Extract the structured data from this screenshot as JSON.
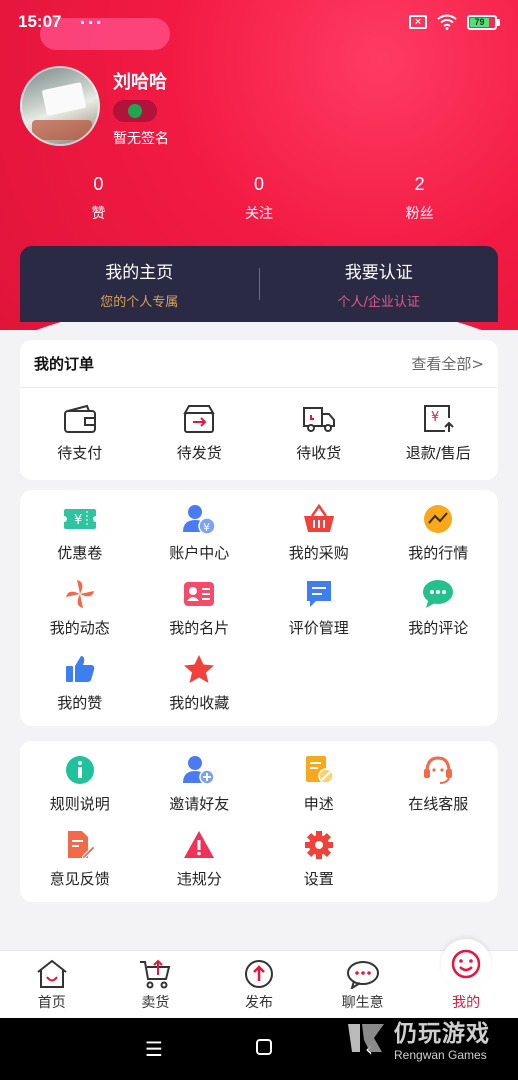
{
  "status": {
    "time": "15:07",
    "dots": "···",
    "battery": "79"
  },
  "profile": {
    "name": "刘哈哈",
    "signature": "暂无签名"
  },
  "stats": [
    {
      "value": "0",
      "label": "赞"
    },
    {
      "value": "0",
      "label": "关注"
    },
    {
      "value": "2",
      "label": "粉丝"
    }
  ],
  "home_card": {
    "left": {
      "title": "我的主页",
      "subtitle": "您的个人专属"
    },
    "right": {
      "title": "我要认证",
      "subtitle": "个人/企业认证"
    }
  },
  "orders": {
    "title": "我的订单",
    "view_all": "查看全部>",
    "items": [
      {
        "label": "待支付",
        "icon": "wallet-icon"
      },
      {
        "label": "待发货",
        "icon": "box-send-icon"
      },
      {
        "label": "待收货",
        "icon": "truck-icon"
      },
      {
        "label": "退款/售后",
        "icon": "refund-icon"
      }
    ]
  },
  "services": {
    "items": [
      {
        "label": "优惠卷",
        "icon": "coupon-icon",
        "color": "#2fc4a0"
      },
      {
        "label": "账户中心",
        "icon": "account-icon",
        "color": "#4a7bf0"
      },
      {
        "label": "我的采购",
        "icon": "basket-icon",
        "color": "#f0423a"
      },
      {
        "label": "我的行情",
        "icon": "trend-icon",
        "color": "#f7a81b"
      },
      {
        "label": "我的动态",
        "icon": "pinwheel-icon",
        "color": "#f26a4a"
      },
      {
        "label": "我的名片",
        "icon": "card-icon",
        "color": "#f24c6a"
      },
      {
        "label": "评价管理",
        "icon": "review-icon",
        "color": "#3e7ef0"
      },
      {
        "label": "我的评论",
        "icon": "comment-icon",
        "color": "#24c08d"
      },
      {
        "label": "我的赞",
        "icon": "thumb-icon",
        "color": "#3e7ef0"
      },
      {
        "label": "我的收藏",
        "icon": "star-icon",
        "color": "#f0423a"
      }
    ]
  },
  "help": {
    "items": [
      {
        "label": "规则说明",
        "icon": "info-icon",
        "color": "#1fc29a"
      },
      {
        "label": "邀请好友",
        "icon": "add-user-icon",
        "color": "#4a7bf0"
      },
      {
        "label": "申述",
        "icon": "appeal-icon",
        "color": "#f7a81b"
      },
      {
        "label": "在线客服",
        "icon": "headset-icon",
        "color": "#f26a4a"
      },
      {
        "label": "意见反馈",
        "icon": "feedback-icon",
        "color": "#f26a4a"
      },
      {
        "label": "违规分",
        "icon": "warning-icon",
        "color": "#f0325a"
      },
      {
        "label": "设置",
        "icon": "gear-icon",
        "color": "#f0423a"
      }
    ]
  },
  "tabbar": [
    {
      "label": "首页",
      "icon": "home-icon"
    },
    {
      "label": "卖货",
      "icon": "cart-icon"
    },
    {
      "label": "发布",
      "icon": "publish-icon"
    },
    {
      "label": "聊生意",
      "icon": "chat-icon"
    },
    {
      "label": "我的",
      "icon": "smile-icon",
      "active": true
    }
  ],
  "watermark": {
    "cn": "仍玩游戏",
    "en": "Rengwan Games"
  }
}
